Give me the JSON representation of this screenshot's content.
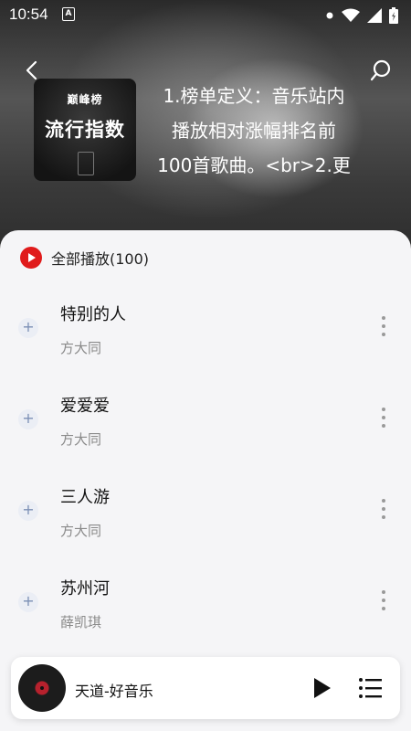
{
  "status": {
    "time": "10:54",
    "notif_glyph": "A"
  },
  "header": {
    "cover_small": "巅峰榜",
    "cover_big": "流行指数",
    "description_lines": [
      "1.榜单定义：音乐站内",
      "播放相对涨幅排名前",
      "100首歌曲。<br>2.更"
    ]
  },
  "play_all_label": "全部播放(100)",
  "songs": [
    {
      "title": "特别的人",
      "artist": "方大同"
    },
    {
      "title": "爱爱爱",
      "artist": "方大同"
    },
    {
      "title": "三人游",
      "artist": "方大同"
    },
    {
      "title": "苏州河",
      "artist": "薛凯琪"
    }
  ],
  "player": {
    "now_playing": "天道-好音乐"
  },
  "colors": {
    "accent": "#e01b1b",
    "add_icon": "#7b8fb5",
    "sheet_bg": "#f5f5f7"
  },
  "icons": {
    "back": "back-arrow-icon",
    "search": "search-icon",
    "play_all": "play-circle-icon",
    "add": "plus-icon",
    "more": "more-vertical-icon",
    "play": "play-icon",
    "playlist": "playlist-icon"
  }
}
